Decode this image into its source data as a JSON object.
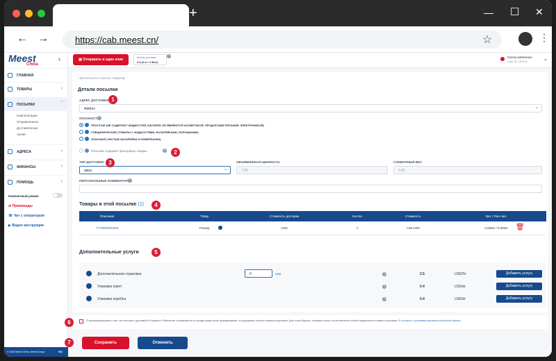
{
  "browser": {
    "url": "https://cab.meest.cn/",
    "new_tab": "+",
    "window_controls": [
      "—",
      "☐",
      "✕"
    ]
  },
  "sidebar": {
    "logo": "Meest",
    "logo_sub": "China",
    "collapse": "‹",
    "items": [
      {
        "label": "ГЛАВНАЯ"
      },
      {
        "label": "ТОВАРЫ"
      },
      {
        "label": "ПОСЫЛКИ"
      },
      {
        "label": "АДРЕСА"
      },
      {
        "label": "ФИНАНСЫ"
      },
      {
        "label": "ПОМОЩЬ"
      }
    ],
    "parcels_sub": [
      "Комплектация",
      "Отправленные",
      "Доставленные",
      "Архив"
    ],
    "compact_mode": "Компактный режим",
    "links": [
      "Промокоды",
      "Чат с оператором",
      "Видео инструкция"
    ],
    "footer": "© 2020 Meest China, Meest Group",
    "lang": "RU"
  },
  "header": {
    "send_button": "Отправить в один клик",
    "balance_label": "Баланс доставки",
    "balance_value": "0 $ (0 кг / 0 Вес)",
    "user_name": "Олена Шевченко",
    "user_id": "User ID: 109791"
  },
  "page": {
    "back_link": "‹ ВЕРНУТЬСЯ К СПИСКУ ТОВАРОВ",
    "title": "Детали посылки",
    "address_label": "АДРЕС ДОСТАВКИ *",
    "address_value": "Addres",
    "danger_label": "ОПАСНОСТЬ",
    "danger_options": [
      "ПРОСТЫЕ (НЕ СОДЕРЖАТ ЖИДКОСТЕЙ, БАТАРЕЙ, НЕ ЯВЛЯЮТСЯ КОСМЕТИКОЙ, ПРОДУКТАМИ ПИТАНИЯ, ЭЛЕКТРОНИКОЙ)",
      "СПЕЦИФИЧЕСКИЕ (ТОВАРЫ С ЖИДКОСТЯМИ, БАТАРЕЙКАМИ, ПОРОШКАМИ)",
      "ОПАСНЫЕ (ЧИСТЫЕ БАТАРЕЙКИ И ПАВЕРБАНКИ)"
    ],
    "brand_option": "Посылка содержит брендовые товары",
    "delivery_type_label": "ТИП ДОСТАВКИ",
    "delivery_type_value": "авиа",
    "declared_label": "ОБЪЯВЛЕННАЯ ЦЕННОСТЬ",
    "declared_value": "7,89",
    "weight_label": "СУММАРНЫЙ ВЕС",
    "weight_value": "0.05",
    "comments_label": "ПЕРСОНАЛЬНЫЕ КОММЕНТАРИИ",
    "goods_title": "Товары в этой посылке",
    "goods_count": "(1)",
    "table_headers": [
      "Описание",
      "Товар",
      "Стоимость доставки",
      "Кол-во",
      "Стоимость",
      "Вес / Расч вес"
    ],
    "table_row": [
      "7770000000058",
      "Пэнкер",
      "USD",
      "1",
      "7,89 USD",
      "0,092кг / 0,092кг"
    ],
    "services_title": "Дополнительные услуги",
    "services": [
      {
        "name": "Дополнительная страховка",
        "input": "0",
        "currency": "USD",
        "price": "2.5",
        "unit": "USD/%",
        "button": "Добавить услугу"
      },
      {
        "name": "Упаковка пакет",
        "price": "0.4",
        "unit": "USD/кг",
        "button": "Добавить услугу"
      },
      {
        "name": "Упаковка коробка",
        "price": "0.4",
        "unit": "USD/кг",
        "button": "Добавить услугу"
      }
    ],
    "agreement_text": "Я проинформирован о том, что посылки с доставкой в Украину и Узбекистан отправляются со склада сразу после формирования, не дожидаясь оплаты стоимости доставки. Для стран Европы, отправка только после внесения полной предоплаты стоимости доставки.",
    "agreement_link": "Я согласен с условиями договора публичной оферты.",
    "save_button": "Сохранить",
    "cancel_button": "Отменить"
  },
  "markers": [
    "1",
    "2",
    "3",
    "4",
    "5",
    "6",
    "7"
  ],
  "colors": {
    "brand_red": "#d9112a",
    "brand_blue": "#174a8c",
    "marker": "#d61f36"
  }
}
